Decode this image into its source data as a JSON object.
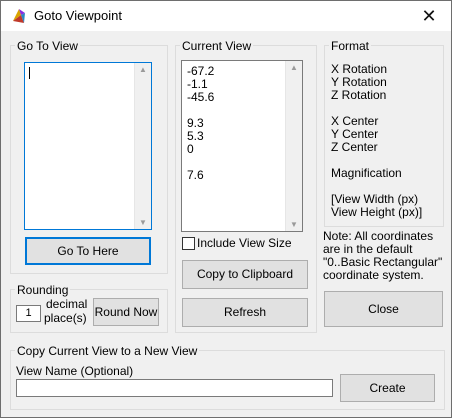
{
  "window": {
    "title": "Goto Viewpoint",
    "close_glyph": "✕"
  },
  "goto_view": {
    "label": "Go To View",
    "button": "Go To Here"
  },
  "rounding": {
    "label": "Rounding",
    "value": "1",
    "unit_line1": "decimal",
    "unit_line2": "place(s)",
    "round_button": "Round Now"
  },
  "current_view": {
    "label": "Current View",
    "values": [
      "-67.2",
      "-1.1",
      "-45.6",
      "",
      "9.3",
      "5.3",
      "0",
      "",
      "7.6"
    ],
    "include_view_size_label": "Include View Size",
    "include_view_size_checked": false,
    "copy_button": "Copy to Clipboard",
    "refresh_button": "Refresh"
  },
  "format": {
    "label": "Format",
    "lines": [
      "X Rotation",
      "Y Rotation",
      "Z Rotation",
      "",
      "X Center",
      "Y Center",
      "Z Center",
      "",
      "Magnification",
      "",
      "[View Width (px)",
      "View Height (px)]"
    ],
    "note_lines": [
      "Note:  All coordinates",
      "are in the default",
      "\"0..Basic Rectangular\"",
      "coordinate system."
    ],
    "close_button": "Close"
  },
  "copy_view": {
    "label": "Copy Current View to a New View",
    "name_label": "View Name (Optional)",
    "name_value": "",
    "create_button": "Create"
  }
}
